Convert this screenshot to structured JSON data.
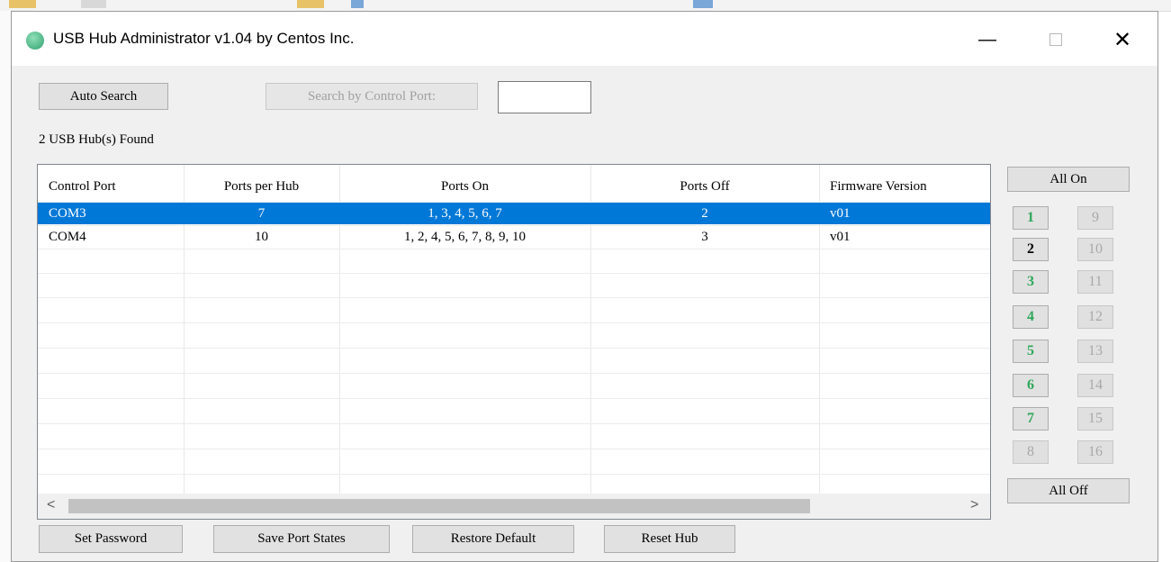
{
  "window": {
    "title": "USB Hub Administrator v1.04 by Centos Inc.",
    "minimize": "—",
    "close": "✕"
  },
  "toolbar": {
    "auto_search_label": "Auto Search",
    "search_by_port_label": "Search by Control Port:",
    "port_input_value": "",
    "status": "2 USB Hub(s) Found"
  },
  "table": {
    "columns": [
      "Control Port",
      "Ports per Hub",
      "Ports On",
      "Ports Off",
      "Firmware Version"
    ],
    "rows": [
      [
        "COM3",
        "7",
        "1, 3, 4, 5, 6, 7",
        "2",
        "v01"
      ],
      [
        "COM4",
        "10",
        "1, 2, 4, 5, 6, 7, 8, 9, 10",
        "3",
        "v01"
      ]
    ],
    "selected_row": 0,
    "scroll_left": "<",
    "scroll_right": ">"
  },
  "ports": {
    "all_on_label": "All On",
    "all_off_label": "All Off",
    "left": [
      "1",
      "2",
      "3",
      "4",
      "5",
      "6",
      "7",
      "8"
    ],
    "right": [
      "9",
      "10",
      "11",
      "12",
      "13",
      "14",
      "15",
      "16"
    ]
  },
  "footer": {
    "set_password": "Set Password",
    "save_port_states": "Save Port States",
    "restore_default": "Restore Default",
    "reset_hub": "Reset Hub"
  },
  "colors": {
    "selection": "#0078d7",
    "port_on": "#2ea85a"
  }
}
